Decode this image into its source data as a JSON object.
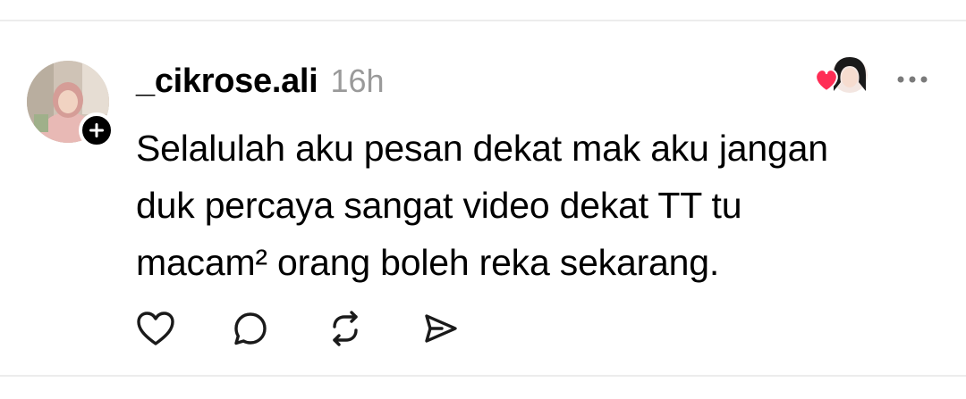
{
  "post": {
    "author": {
      "username": "_cikrose.ali",
      "avatar_icon": "profile-photo",
      "follow_icon": "plus-icon"
    },
    "timestamp": "16h",
    "text": "Selalulah aku pesan dekat mak aku jangan\nduk percaya sangat video dekat TT tu\nmacam² orang boleh reka sekarang.",
    "liked_by_icon": "heart-icon",
    "more_icon": "more-horizontal-icon",
    "actions": [
      {
        "name": "like",
        "icon": "heart-outline-icon"
      },
      {
        "name": "reply",
        "icon": "comment-bubble-icon"
      },
      {
        "name": "repost",
        "icon": "repost-icon"
      },
      {
        "name": "share",
        "icon": "send-icon"
      }
    ]
  },
  "colors": {
    "text": "#000000",
    "muted": "#9a9a9a",
    "heart": "#ff2d55",
    "divider": "#ececec"
  }
}
